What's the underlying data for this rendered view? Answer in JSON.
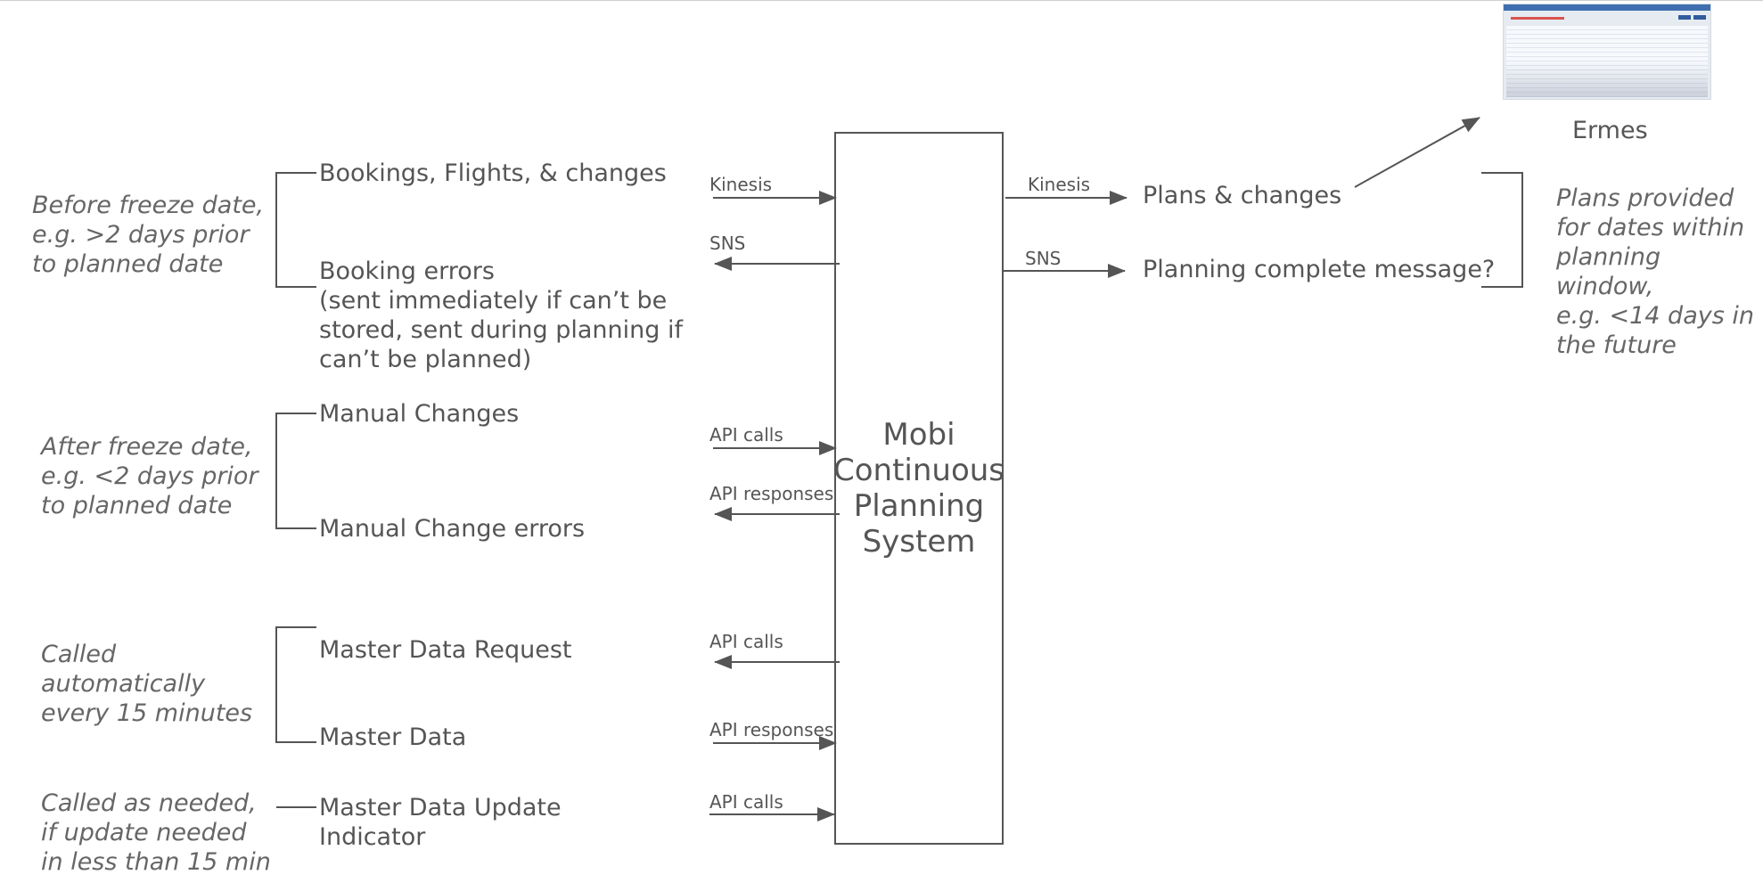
{
  "central_box": {
    "label": "Mobi\nContinuous\nPlanning\nSystem"
  },
  "left_notes": {
    "before_freeze": "Before freeze date,\ne.g. >2 days prior\nto planned date",
    "after_freeze": "After freeze date,\ne.g. <2 days prior\nto planned date",
    "called_auto": "Called\nautomatically\nevery 15 minutes",
    "called_needed": "Called as needed,\nif update needed\nin less than 15 min"
  },
  "left_items": {
    "bookings": "Bookings, Flights, & changes",
    "booking_errors": "Booking errors\n(sent immediately if can’t be\nstored, sent during planning if\ncan’t be planned)",
    "manual_changes": "Manual Changes",
    "manual_change_errors": "Manual Change errors",
    "master_data_request": "Master Data Request",
    "master_data": "Master Data",
    "master_data_update": "Master Data Update\nIndicator"
  },
  "left_arrows": {
    "kinesis": "Kinesis",
    "sns": "SNS",
    "api_calls_1": "API calls",
    "api_responses_1": "API responses",
    "api_calls_2": "API calls",
    "api_responses_2": "API responses",
    "api_calls_3": "API calls"
  },
  "right_arrows": {
    "kinesis": "Kinesis",
    "sns": "SNS"
  },
  "right_items": {
    "plans_changes": "Plans & changes",
    "planning_complete": "Planning complete message?"
  },
  "right_note": "Plans provided\nfor dates within\nplanning window,\ne.g. <14 days in\nthe future",
  "ermes": {
    "label": "Ermes",
    "thumbnail": "ermes-app-screenshot"
  },
  "colors": {
    "line": "#555555",
    "text": "#555555",
    "note": "#666666"
  }
}
